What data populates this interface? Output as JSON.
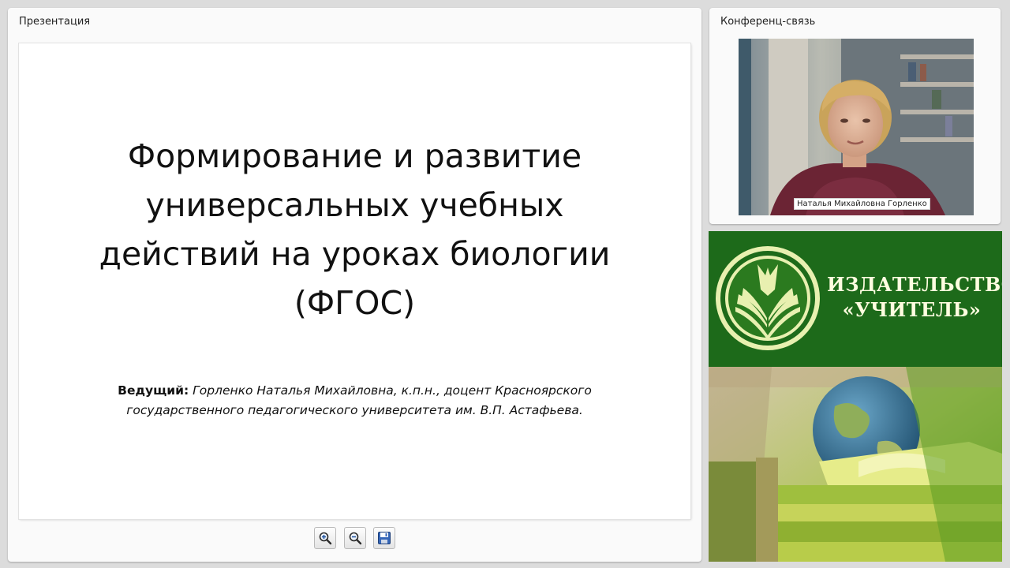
{
  "presentation": {
    "panel_title": "Презентация",
    "slide": {
      "title_lines": [
        "Формирование и развитие",
        "универсальных учебных",
        "действий на уроках биологии",
        "(ФГОС)"
      ],
      "presenter_label": "Ведущий:",
      "presenter_line1": "Горленко Наталья Михайловна, к.п.н., доцент Красноярского",
      "presenter_line2": "государственного педагогического университета им. В.П. Астафьева."
    },
    "toolbar": {
      "zoom_in_icon": "zoom-in-icon",
      "zoom_out_icon": "zoom-out-icon",
      "save_icon": "floppy-disk-icon"
    }
  },
  "conference": {
    "panel_title": "Конференц-связь",
    "participant_name": "Наталья Михайловна Горленко"
  },
  "ad": {
    "publisher_line1": "ИЗДАТЕЛЬСТВО",
    "publisher_line2": "«УЧИТЕЛЬ»",
    "brand_green": "#1d6a1a",
    "brand_text": "#fffde0"
  }
}
